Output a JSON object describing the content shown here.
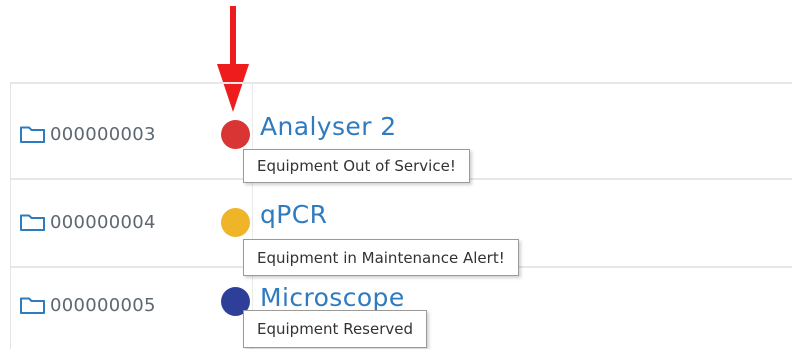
{
  "annotation": {
    "arrow_color": "#ee1c1c",
    "icon": "down-arrow-icon"
  },
  "equipment_rows": [
    {
      "id": "000000003",
      "name": "Analyser 2",
      "status_color": "#d93535",
      "status_tooltip": "Equipment Out of Service!",
      "icon": "folder-icon"
    },
    {
      "id": "000000004",
      "name": "qPCR",
      "status_color": "#f0b429",
      "status_tooltip": "Equipment in Maintenance Alert!",
      "icon": "folder-icon"
    },
    {
      "id": "000000005",
      "name": "Microscope",
      "status_color": "#2e3f99",
      "status_tooltip": "Equipment Reserved",
      "icon": "folder-icon"
    }
  ],
  "colors": {
    "link": "#2f7bbf",
    "id_text": "#5f6770",
    "row_border": "#e7e7e7"
  }
}
